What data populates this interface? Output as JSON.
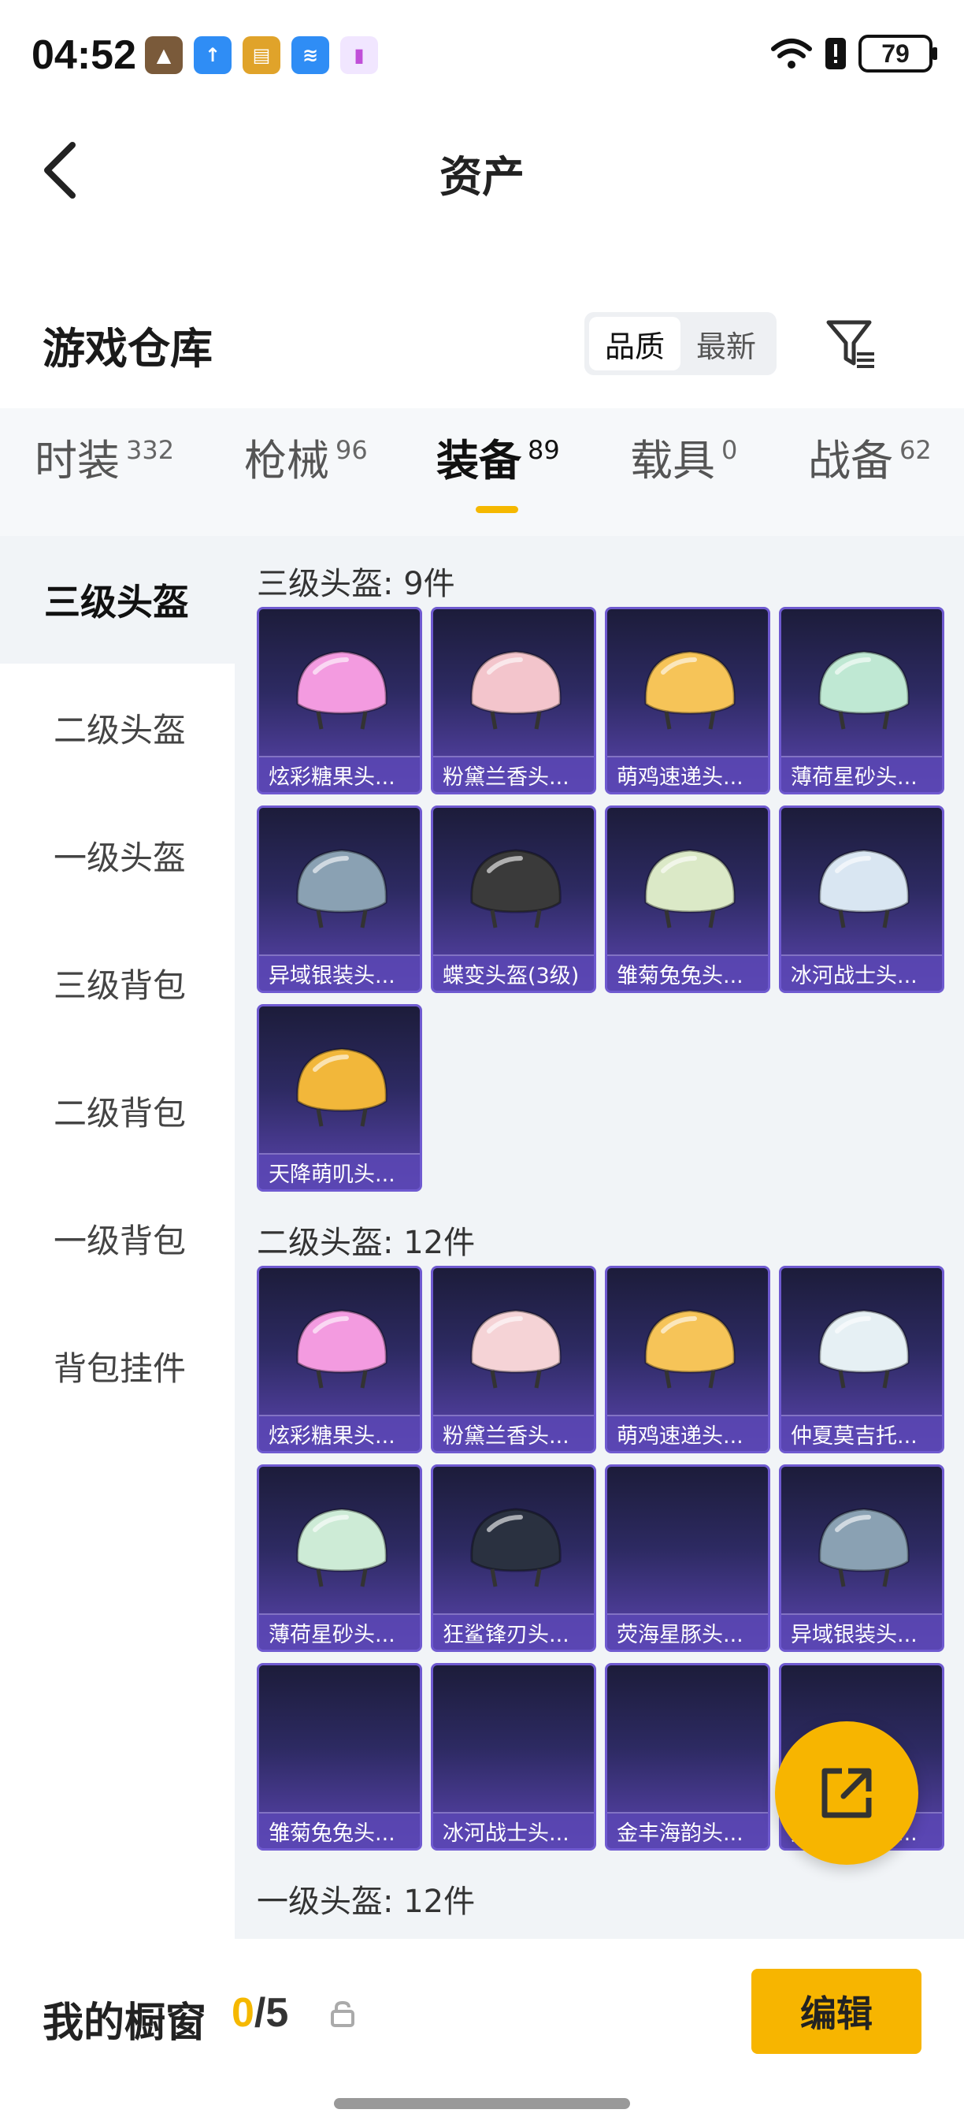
{
  "status_bar": {
    "time": "04:52",
    "battery": "79"
  },
  "header": {
    "title": "资产"
  },
  "warehouse": {
    "title": "游戏仓库",
    "sort_options": [
      "品质",
      "最新"
    ],
    "active_sort": "品质"
  },
  "tabs": [
    {
      "label": "时装",
      "count": "332"
    },
    {
      "label": "枪械",
      "count": "96"
    },
    {
      "label": "装备",
      "count": "89"
    },
    {
      "label": "载具",
      "count": "0"
    },
    {
      "label": "战备",
      "count": "62"
    }
  ],
  "active_tab": "装备",
  "sidebar": [
    "三级头盔",
    "二级头盔",
    "一级头盔",
    "三级背包",
    "二级背包",
    "一级背包",
    "背包挂件"
  ],
  "sections": [
    {
      "title": "三级头盔: 9件",
      "items": [
        {
          "name": "炫彩糖果头...",
          "icon": "candy-helmet-icon",
          "color": "#f39be0"
        },
        {
          "name": "粉黛兰香头...",
          "icon": "pink-helmet-icon",
          "color": "#f3c5cc"
        },
        {
          "name": "萌鸡速递头...",
          "icon": "chick-helmet-icon",
          "color": "#f6c458"
        },
        {
          "name": "薄荷星砂头...",
          "icon": "mint-helmet-icon",
          "color": "#bfe8d3"
        },
        {
          "name": "异域银装头...",
          "icon": "silver-helmet-icon",
          "color": "#8aa1b3"
        },
        {
          "name": "蝶变头盔(3级)",
          "icon": "butterfly-helmet-icon",
          "color": "#3a3a3a"
        },
        {
          "name": "雏菊兔兔头...",
          "icon": "bunny-helmet-icon",
          "color": "#dbe9c7"
        },
        {
          "name": "冰河战士头...",
          "icon": "glacier-helmet-icon",
          "color": "#d9e6f2"
        },
        {
          "name": "天降萌叽头...",
          "icon": "cute-helmet-icon",
          "color": "#f2b73a"
        }
      ]
    },
    {
      "title": "二级头盔: 12件",
      "items": [
        {
          "name": "炫彩糖果头...",
          "icon": "candy-helmet-icon",
          "color": "#f39be0"
        },
        {
          "name": "粉黛兰香头...",
          "icon": "pink-helmet-icon",
          "color": "#f5d3d6"
        },
        {
          "name": "萌鸡速递头...",
          "icon": "chick-helmet-icon",
          "color": "#f6c458"
        },
        {
          "name": "仲夏莫吉托...",
          "icon": "mojito-helmet-icon",
          "color": "#e6f0f4"
        },
        {
          "name": "薄荷星砂头...",
          "icon": "mint-helmet-icon",
          "color": "#cdebd6"
        },
        {
          "name": "狂鲨锋刃头...",
          "icon": "shark-helmet-icon",
          "color": "#2a3140"
        },
        {
          "name": "荧海星豚头...",
          "icon": "dolphin-helmet-icon",
          "color": ""
        },
        {
          "name": "异域银装头...",
          "icon": "silver-helmet-icon",
          "color": "#8aa1b3"
        },
        {
          "name": "雏菊兔兔头...",
          "icon": "bunny-helmet-icon",
          "color": ""
        },
        {
          "name": "冰河战士头...",
          "icon": "glacier-helmet-icon",
          "color": ""
        },
        {
          "name": "金丰海韵头...",
          "icon": "gold-helmet-icon",
          "color": ""
        },
        {
          "name": "天降萌叽头...",
          "icon": "cute-helmet-icon",
          "color": ""
        }
      ]
    },
    {
      "title": "一级头盔: 12件",
      "items": []
    }
  ],
  "showcase": {
    "label": "我的橱窗",
    "current": "0",
    "total": "/5",
    "edit_label": "编辑"
  }
}
